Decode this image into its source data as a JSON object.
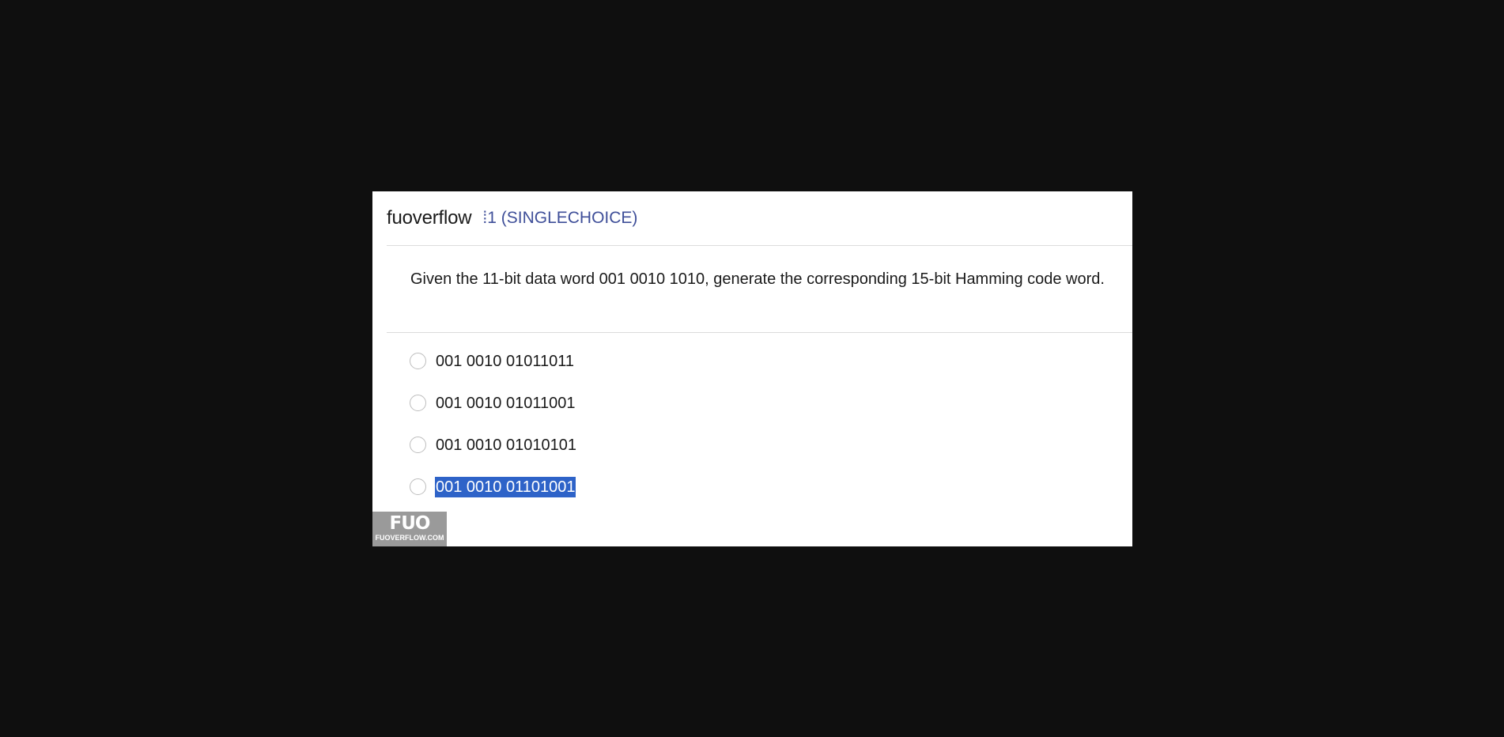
{
  "header": {
    "brand": "fuoverflow",
    "question_type": "⁞1 (SINGLECHOICE)"
  },
  "question": {
    "text": "Given the 11-bit data word 001 0010 1010, generate the corresponding 15-bit Hamming code word."
  },
  "options": [
    {
      "label": "001 0010 01011011",
      "highlighted": false
    },
    {
      "label": "001 0010 01011001",
      "highlighted": false
    },
    {
      "label": "001 0010 01010101",
      "highlighted": false
    },
    {
      "label": "001 0010 01101001",
      "highlighted": true
    }
  ],
  "watermark": {
    "logo_text": "FUO",
    "site_text": "FUOVERFLOW.COM"
  },
  "colors": {
    "background": "#0f0f0f",
    "card": "#ffffff",
    "question_type": "#3f4f99",
    "text_selection": "#2e63c8",
    "watermark_bg": "#9a9a9a"
  }
}
